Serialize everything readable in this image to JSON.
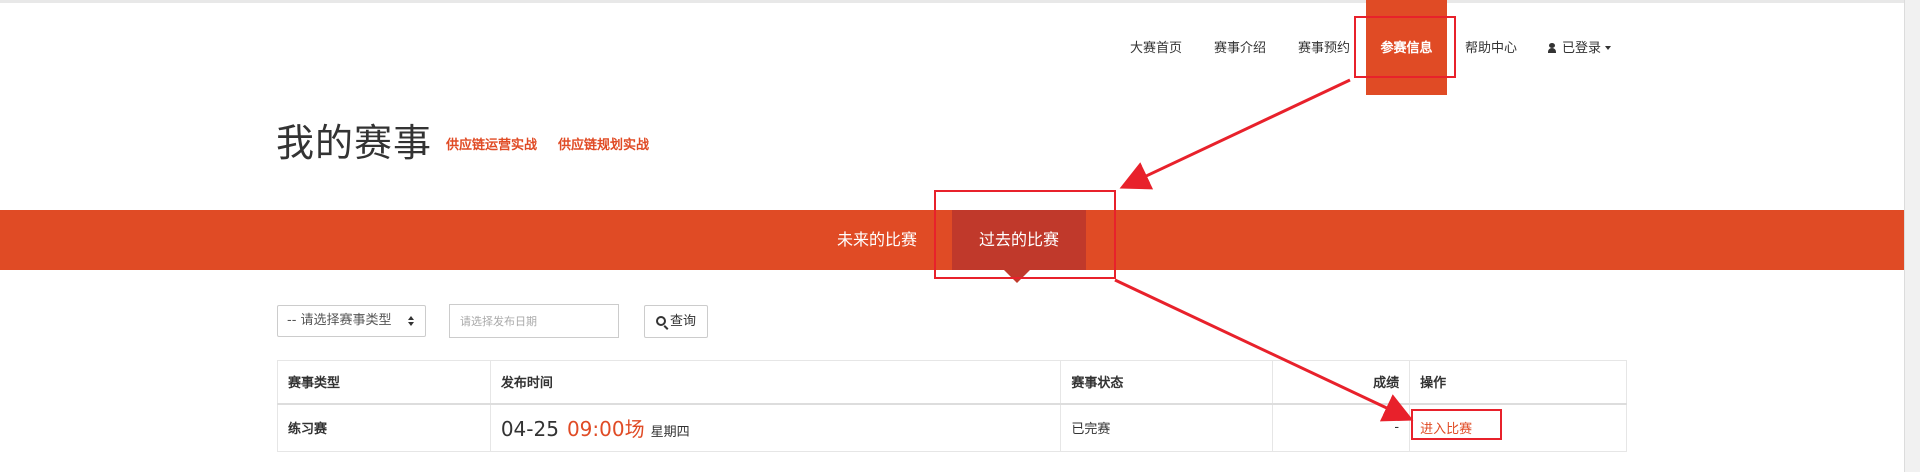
{
  "nav": {
    "items": [
      {
        "label": "大赛首页"
      },
      {
        "label": "赛事介绍"
      },
      {
        "label": "赛事预约"
      },
      {
        "label": "参赛信息"
      },
      {
        "label": "帮助中心"
      },
      {
        "label": "已登录"
      }
    ],
    "active_index": 3
  },
  "page": {
    "title": "我的赛事",
    "sub_links": [
      "供应链运营实战",
      "供应链规划实战"
    ]
  },
  "tabs": {
    "items": [
      "未来的比赛",
      "过去的比赛"
    ],
    "active_index": 1
  },
  "filters": {
    "select_value": "-- 请选择赛事类型",
    "date_placeholder": "请选择发布日期",
    "query_label": "查询"
  },
  "table": {
    "headers": [
      "赛事类型",
      "发布时间",
      "赛事状态",
      "成绩",
      "操作"
    ],
    "rows": [
      {
        "type": "练习赛",
        "date": "04-25",
        "time": "09:00场",
        "weekday": "星期四",
        "status": "已完赛",
        "score": "-",
        "action": "进入比赛"
      }
    ]
  },
  "colors": {
    "accent": "#e04b25",
    "accent_dark": "#c0392b",
    "annotation": "#e8212b"
  },
  "icons": [
    "user-icon",
    "caret-down-icon",
    "select-arrows-icon",
    "search-icon"
  ]
}
